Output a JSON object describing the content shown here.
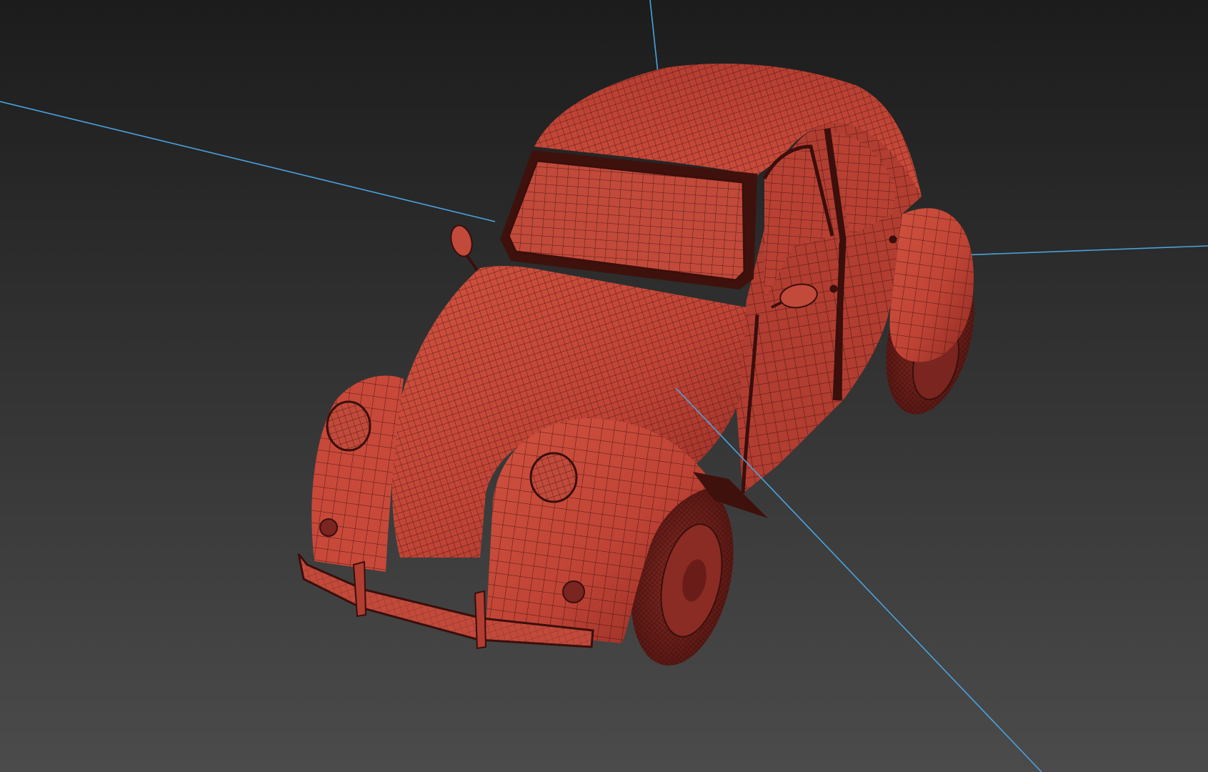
{
  "viewport": {
    "view": "perspective",
    "shading": "flat-red-with-wireframe-edges",
    "background": {
      "top": "#1c1c1c",
      "bottom": "#4b4b4b"
    },
    "object": {
      "name": "",
      "type": "car",
      "body_color": "#c4473a",
      "body_shadow_color": "#8e2a22",
      "wire_color": "#3a0f0c"
    },
    "gizmo": {
      "type": "transform-axes",
      "color": "#4aa3e0"
    }
  }
}
